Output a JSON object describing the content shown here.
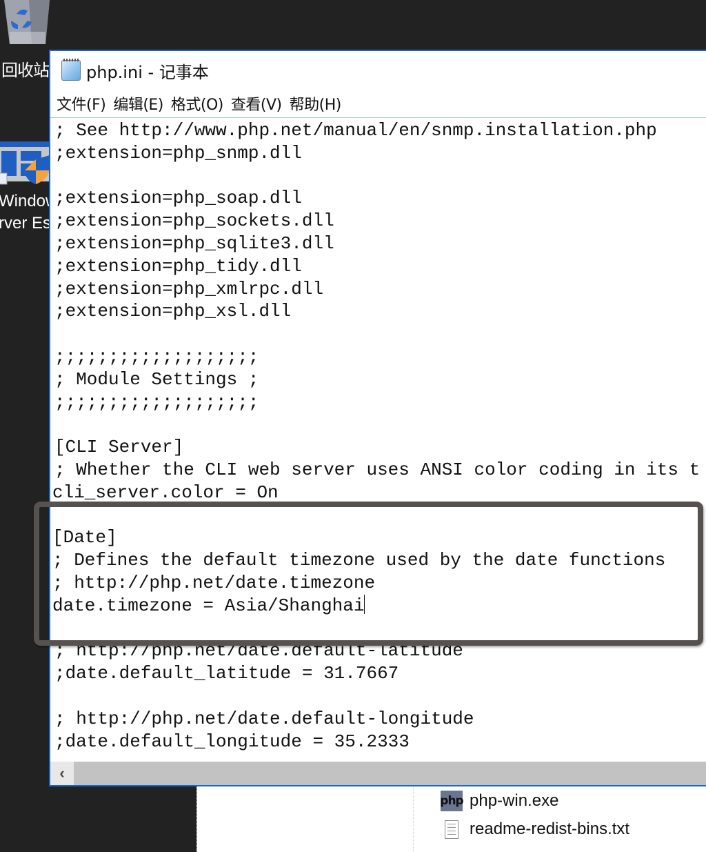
{
  "desktop": {
    "recycle_bin_label": "回收站",
    "server_icon_label_line1": "Window",
    "server_icon_label_line2": "rver Es"
  },
  "notepad": {
    "title": "php.ini - 记事本",
    "menu": [
      {
        "label": "文件(F)"
      },
      {
        "label": "编辑(E)"
      },
      {
        "label": "格式(O)"
      },
      {
        "label": "查看(V)"
      },
      {
        "label": "帮助(H)"
      }
    ],
    "lines": [
      "; See http://www.php.net/manual/en/snmp.installation.php",
      ";extension=php_snmp.dll",
      "",
      ";extension=php_soap.dll",
      ";extension=php_sockets.dll",
      ";extension=php_sqlite3.dll",
      ";extension=php_tidy.dll",
      ";extension=php_xmlrpc.dll",
      ";extension=php_xsl.dll",
      "",
      ";;;;;;;;;;;;;;;;;;;",
      "; Module Settings ;",
      ";;;;;;;;;;;;;;;;;;;",
      "",
      "[CLI Server]",
      "; Whether the CLI web server uses ANSI color coding in its t",
      "cli_server.color = On",
      "",
      "[Date]",
      "; Defines the default timezone used by the date functions",
      "; http://php.net/date.timezone",
      "date.timezone = Asia/Shanghai",
      "",
      "; http://php.net/date.default-latitude",
      ";date.default_latitude = 31.7667",
      "",
      "; http://php.net/date.default-longitude",
      ";date.default_longitude = 35.2333"
    ],
    "caret_line_index": 21,
    "scroll_left_arrow": "‹"
  },
  "explorer": {
    "files": [
      {
        "name": "php-win.exe",
        "icon": "php-icon",
        "icon_text": "php"
      },
      {
        "name": "readme-redist-bins.txt",
        "icon": "text-file-icon"
      }
    ]
  },
  "annotation": {
    "highlight_color": "#57524f",
    "highlighted_lines": [
      19,
      20,
      21,
      22
    ]
  }
}
